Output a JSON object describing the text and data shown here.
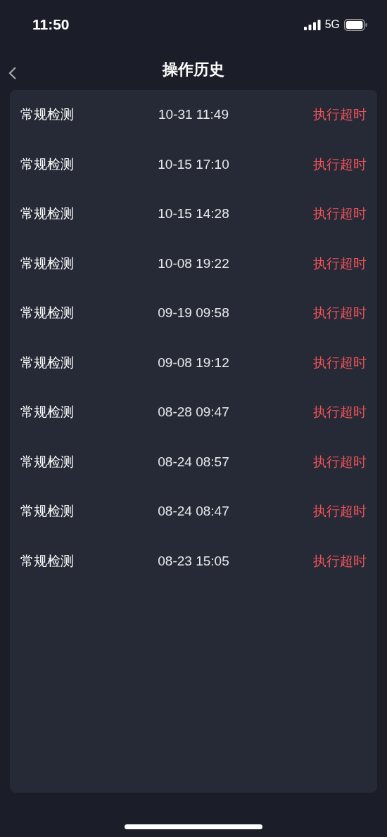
{
  "status_bar": {
    "time": "11:50",
    "network": "5G"
  },
  "header": {
    "title": "操作历史"
  },
  "history": [
    {
      "name": "常规检测",
      "time": "10-31 11:49",
      "result": "执行超时"
    },
    {
      "name": "常规检测",
      "time": "10-15 17:10",
      "result": "执行超时"
    },
    {
      "name": "常规检测",
      "time": "10-15 14:28",
      "result": "执行超时"
    },
    {
      "name": "常规检测",
      "time": "10-08 19:22",
      "result": "执行超时"
    },
    {
      "name": "常规检测",
      "time": "09-19 09:58",
      "result": "执行超时"
    },
    {
      "name": "常规检测",
      "time": "09-08 19:12",
      "result": "执行超时"
    },
    {
      "name": "常规检测",
      "time": "08-28 09:47",
      "result": "执行超时"
    },
    {
      "name": "常规检测",
      "time": "08-24 08:57",
      "result": "执行超时"
    },
    {
      "name": "常规检测",
      "time": "08-24 08:47",
      "result": "执行超时"
    },
    {
      "name": "常规检测",
      "time": "08-23 15:05",
      "result": "执行超时"
    }
  ]
}
